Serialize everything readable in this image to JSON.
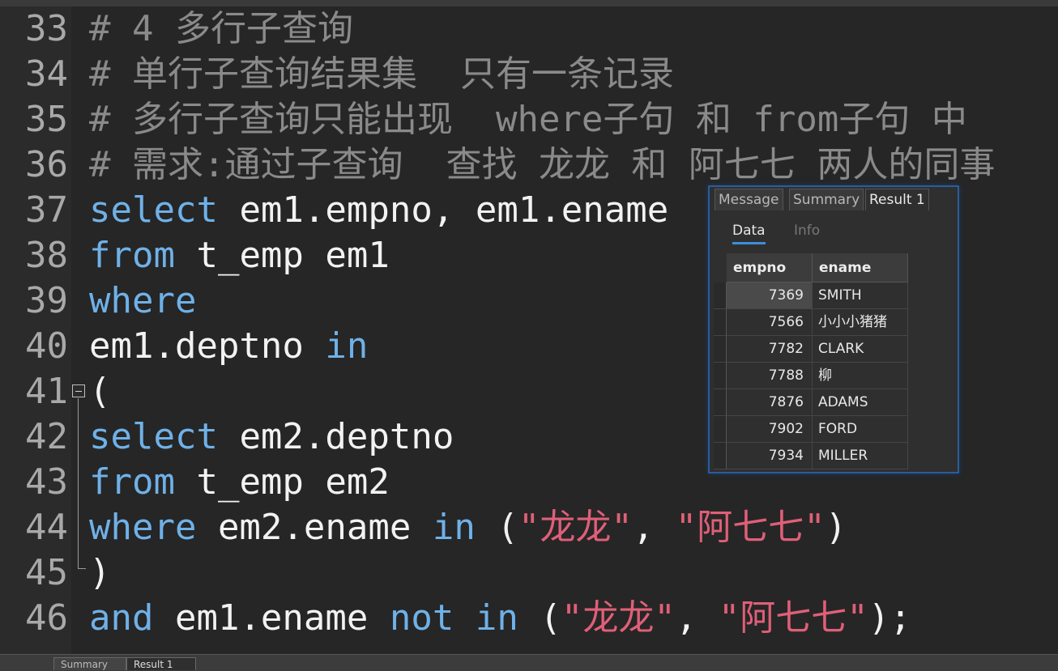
{
  "editor": {
    "lines": [
      {
        "no": "33",
        "parts": [
          {
            "t": "# 4 多行子查询",
            "c": "cm"
          }
        ]
      },
      {
        "no": "34",
        "parts": [
          {
            "t": "# 单行子查询结果集  只有一条记录",
            "c": "cm"
          }
        ]
      },
      {
        "no": "35",
        "parts": [
          {
            "t": "# 多行子查询只能出现  where子句 和 from子句 中",
            "c": "cm"
          }
        ]
      },
      {
        "no": "36",
        "parts": [
          {
            "t": "# 需求:通过子查询  查找 龙龙 和 阿七七 两人的同事",
            "c": "cm"
          }
        ]
      },
      {
        "no": "37",
        "parts": [
          {
            "t": "select",
            "c": "kw"
          },
          {
            "t": " em1.empno, em1.ename",
            "c": ""
          }
        ]
      },
      {
        "no": "38",
        "parts": [
          {
            "t": "from",
            "c": "kw"
          },
          {
            "t": " t_emp em1",
            "c": ""
          }
        ]
      },
      {
        "no": "39",
        "parts": [
          {
            "t": "where",
            "c": "kw"
          }
        ]
      },
      {
        "no": "40",
        "parts": [
          {
            "t": "em1.deptno ",
            "c": ""
          },
          {
            "t": "in",
            "c": "kw"
          }
        ]
      },
      {
        "no": "41",
        "parts": [
          {
            "t": "(",
            "c": ""
          }
        ]
      },
      {
        "no": "42",
        "parts": [
          {
            "t": "select",
            "c": "kw"
          },
          {
            "t": " em2.deptno",
            "c": ""
          }
        ]
      },
      {
        "no": "43",
        "parts": [
          {
            "t": "from",
            "c": "kw"
          },
          {
            "t": " t_emp em2",
            "c": ""
          }
        ]
      },
      {
        "no": "44",
        "parts": [
          {
            "t": "where",
            "c": "kw"
          },
          {
            "t": " em2.ename ",
            "c": ""
          },
          {
            "t": "in",
            "c": "kw"
          },
          {
            "t": " (",
            "c": ""
          },
          {
            "t": "\"龙龙\"",
            "c": "st"
          },
          {
            "t": ", ",
            "c": ""
          },
          {
            "t": "\"阿七七\"",
            "c": "st"
          },
          {
            "t": ")",
            "c": ""
          }
        ]
      },
      {
        "no": "45",
        "parts": [
          {
            "t": ")",
            "c": ""
          }
        ]
      },
      {
        "no": "46",
        "parts": [
          {
            "t": "and",
            "c": "kw"
          },
          {
            "t": " em1.ename ",
            "c": ""
          },
          {
            "t": "not",
            "c": "kw"
          },
          {
            "t": " ",
            "c": ""
          },
          {
            "t": "in",
            "c": "kw"
          },
          {
            "t": " (",
            "c": ""
          },
          {
            "t": "\"龙龙\"",
            "c": "st"
          },
          {
            "t": ", ",
            "c": ""
          },
          {
            "t": "\"阿七七\"",
            "c": "st"
          },
          {
            "t": ");",
            "c": ""
          }
        ]
      }
    ]
  },
  "result_panel": {
    "tabs": [
      "Message",
      "Summary",
      "Result 1"
    ],
    "active_tab": "Result 1",
    "subtabs": [
      "Data",
      "Info"
    ],
    "active_subtab": "Data",
    "columns": [
      "empno",
      "ename"
    ],
    "rows": [
      [
        "7369",
        "SMITH"
      ],
      [
        "7566",
        "小小小猪猪"
      ],
      [
        "7782",
        "CLARK"
      ],
      [
        "7788",
        "柳"
      ],
      [
        "7876",
        "ADAMS"
      ],
      [
        "7902",
        "FORD"
      ],
      [
        "7934",
        "MILLER"
      ]
    ]
  },
  "bottom_tabs": [
    "Summary",
    "Result 1"
  ],
  "colors": {
    "keyword": "#6fb1e8",
    "string": "#e05f78",
    "comment": "#8a8a8a",
    "selection_border": "#2b5c9a"
  }
}
